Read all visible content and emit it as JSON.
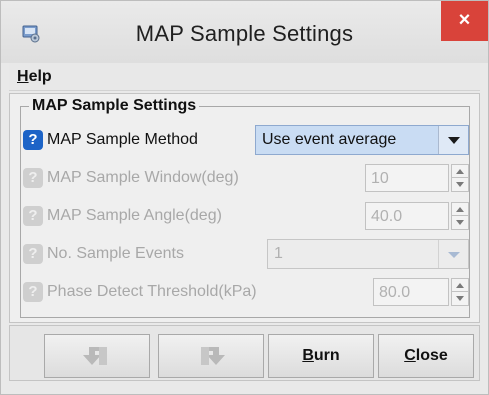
{
  "window": {
    "title": "MAP Sample Settings",
    "close_glyph": "×",
    "icon": "app-settings-icon"
  },
  "menubar": {
    "help_mnemonic": "H",
    "help_rest": "elp"
  },
  "group": {
    "title": "MAP Sample Settings"
  },
  "settings": {
    "method": {
      "label": "MAP Sample Method",
      "value": "Use event average",
      "enabled": true
    },
    "window": {
      "label": "MAP Sample Window(deg)",
      "value": "10",
      "enabled": false
    },
    "angle": {
      "label": "MAP Sample Angle(deg)",
      "value": "40.0",
      "enabled": false
    },
    "events": {
      "label": "No. Sample Events",
      "value": "1",
      "enabled": false
    },
    "threshold": {
      "label": "Phase Detect Threshold(kPa)",
      "value": "80.0",
      "enabled": false
    }
  },
  "help_icon_glyph": "?",
  "buttons": {
    "undo": {
      "icon": "undo-icon",
      "enabled": false
    },
    "redo": {
      "icon": "redo-icon",
      "enabled": false
    },
    "burn": {
      "mnemonic": "B",
      "rest": "urn"
    },
    "close": {
      "mnemonic": "C",
      "rest": "lose"
    }
  },
  "colors": {
    "close_button": "#d9433a",
    "help_icon_active": "#1d64c7",
    "selected_dropdown": "#c9dcf3",
    "disabled_text": "#a8a8a8"
  }
}
